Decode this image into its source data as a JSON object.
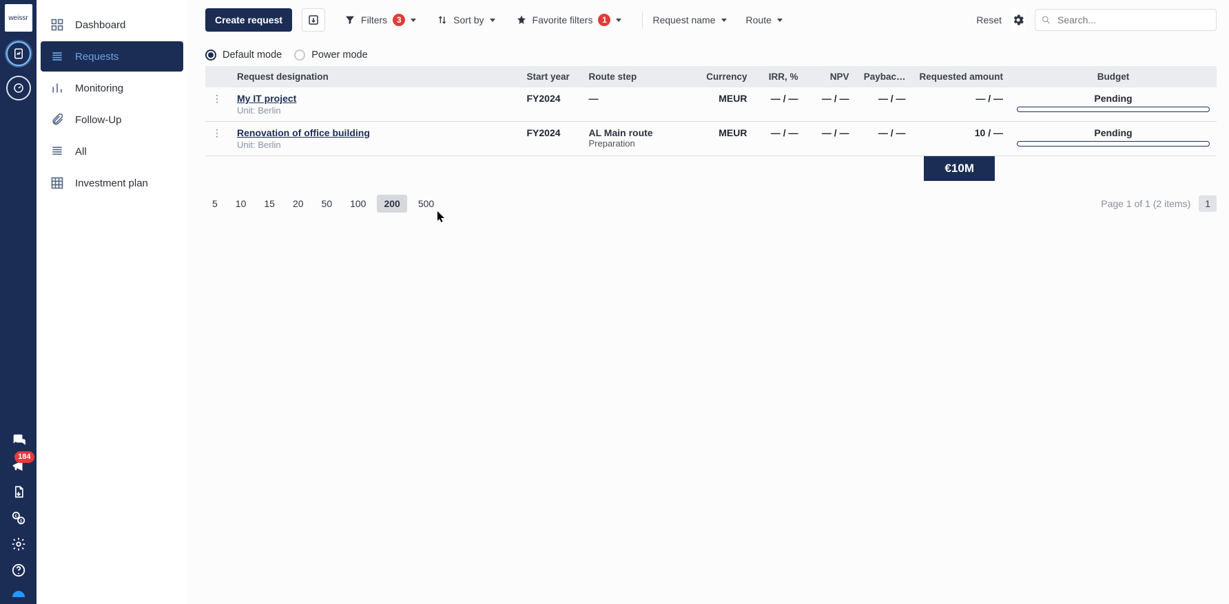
{
  "rail": {
    "logo": "weissr",
    "notif_count": "184"
  },
  "sidebar": {
    "items": [
      {
        "label": "Dashboard"
      },
      {
        "label": "Requests"
      },
      {
        "label": "Monitoring"
      },
      {
        "label": "Follow-Up"
      },
      {
        "label": "All"
      },
      {
        "label": "Investment plan"
      }
    ]
  },
  "toolbar": {
    "create": "Create request",
    "filters": "Filters",
    "filters_count": "3",
    "sort": "Sort by",
    "fav": "Favorite filters",
    "fav_count": "1",
    "request_name": "Request name",
    "route": "Route",
    "reset": "Reset",
    "search_placeholder": "Search..."
  },
  "mode": {
    "default": "Default mode",
    "power": "Power mode"
  },
  "columns": {
    "designation": "Request designation",
    "start_year": "Start year",
    "route_step": "Route step",
    "currency": "Currency",
    "irr": "IRR, %",
    "npv": "NPV",
    "payback": "Paybac…",
    "requested": "Requested amount",
    "budget": "Budget"
  },
  "rows": [
    {
      "title": "My IT project",
      "unit": "Unit: Berlin",
      "year": "FY2024",
      "route_main": "—",
      "route_sub": "",
      "currency": "MEUR",
      "irr": "— / —",
      "npv": "— / —",
      "payback": "— / —",
      "requested": "— / —",
      "status": "Pending"
    },
    {
      "title": "Renovation of office building",
      "unit": "Unit: Berlin",
      "year": "FY2024",
      "route_main": "AL Main route",
      "route_sub": "Preparation",
      "currency": "MEUR",
      "irr": "— / —",
      "npv": "— / —",
      "payback": "— / —",
      "requested": "10 / —",
      "status": "Pending"
    }
  ],
  "totals": {
    "requested": "€10M"
  },
  "pager": {
    "sizes": [
      "5",
      "10",
      "15",
      "20",
      "50",
      "100",
      "200",
      "500"
    ],
    "active_size": "200",
    "info": "Page 1 of 1 (2 items)",
    "current": "1"
  }
}
